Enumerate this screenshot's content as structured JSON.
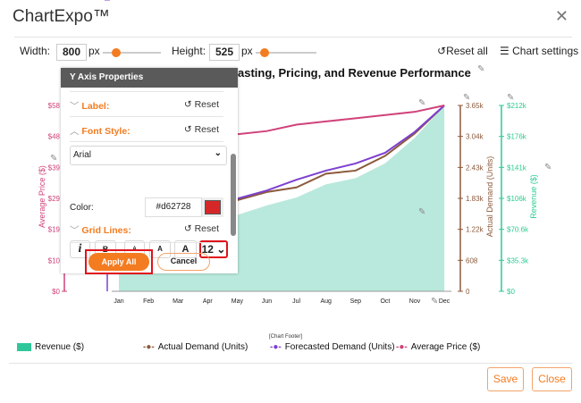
{
  "app": {
    "title": "ChartExpo™",
    "close_icon": "close-icon"
  },
  "toolbar": {
    "width_label": "Width:",
    "width_value": "800",
    "width_unit": "px",
    "width_slider": 0.25,
    "height_label": "Height:",
    "height_value": "525",
    "height_unit": "px",
    "height_slider": 0.25,
    "reset_all": "Reset all",
    "chart_settings": "Chart settings"
  },
  "panel": {
    "title": "Y Axis Properties",
    "label_section": "Label:",
    "font_style_section": "Font Style:",
    "grid_lines_section": "Grid Lines:",
    "reset": "Reset",
    "font_family": "Arial",
    "italic": "i",
    "bold": "B",
    "size_small": "A",
    "size_medium": "A",
    "size_large": "A",
    "font_size": "12",
    "color_label": "Color:",
    "color_value": "#d62728",
    "apply_all": "Apply All",
    "cancel": "Cancel"
  },
  "footer_label": "[Chart Footer]",
  "buttons": {
    "save": "Save",
    "close": "Close"
  },
  "colors": {
    "accent": "#f47c20",
    "revenue": "#b9e9dc",
    "revenue_axis": "#2ecc8f",
    "demand": "#8c5a3c",
    "forecast": "#7d3fd1",
    "price": "#d0427a",
    "highlight": "#e0121b"
  },
  "chart_data": {
    "type": "line",
    "title": "asting, Pricing, and Revenue Performance",
    "categories": [
      "Jan",
      "Feb",
      "Mar",
      "Apr",
      "May",
      "Jun",
      "Jul",
      "Aug",
      "Sep",
      "Oct",
      "Nov",
      "Dec"
    ],
    "series": [
      {
        "name": "Revenue ($)",
        "type": "area",
        "axis": "revenue",
        "values": [
          70,
          75,
          80,
          85,
          87,
          98,
          107,
          122,
          129,
          146,
          175,
          212
        ]
      },
      {
        "name": "Actual Demand (Units)",
        "type": "line",
        "axis": "demand",
        "values": [
          1.25,
          1.4,
          1.55,
          1.68,
          1.79,
          1.95,
          2.04,
          2.31,
          2.37,
          2.66,
          3.1,
          3.65
        ]
      },
      {
        "name": "Forecasted Demand (Units)",
        "type": "line",
        "axis": "forecast",
        "values": [
          1.3,
          1.45,
          1.6,
          1.72,
          1.82,
          1.98,
          2.19,
          2.37,
          2.51,
          2.72,
          3.13,
          3.65
        ]
      },
      {
        "name": "Average Price ($)",
        "type": "line",
        "axis": "price",
        "values": [
          46,
          47,
          48,
          48.5,
          49,
          50,
          52,
          53,
          54,
          55,
          56,
          58
        ]
      }
    ],
    "axes": {
      "price": {
        "label": "Average Price ($)",
        "ticks": [
          "$0",
          "$10",
          "$19",
          "$29",
          "$39",
          "$48",
          "$58"
        ],
        "range": [
          0,
          58
        ]
      },
      "forecast": {
        "ticks": [
          "0"
        ],
        "range": [
          0,
          3.65
        ]
      },
      "demand": {
        "label": "Actual Demand (Units)",
        "ticks": [
          "0",
          "608",
          "1.22k",
          "1.83k",
          "2.43k",
          "3.04k",
          "3.65k"
        ],
        "range": [
          0,
          3.65
        ]
      },
      "revenue": {
        "label": "Revenue ($)",
        "ticks": [
          "$0",
          "$35.3k",
          "$70.6k",
          "$106k",
          "$141k",
          "$176k",
          "$212k"
        ],
        "range": [
          0,
          212
        ]
      }
    },
    "legend_placement": "bottom"
  }
}
